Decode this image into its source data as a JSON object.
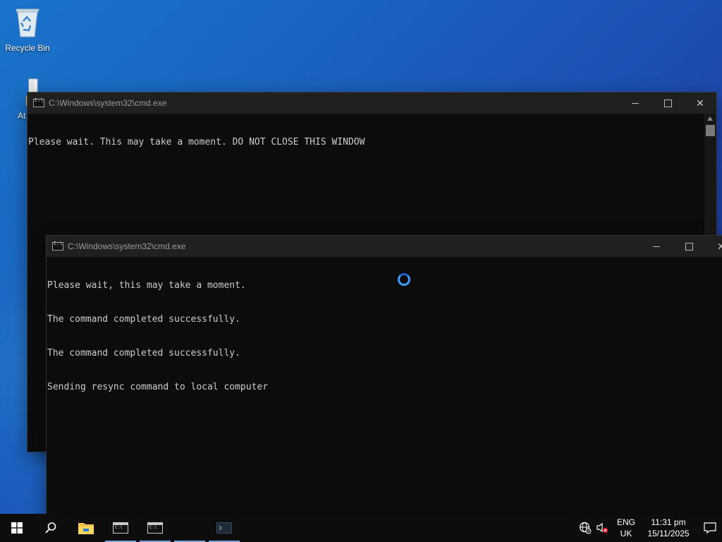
{
  "desktop": {
    "icons": [
      {
        "label": "Recycle Bin",
        "icon": "recycle-bin-icon"
      },
      {
        "label": "At",
        "icon": "folder-icon"
      }
    ]
  },
  "windows": [
    {
      "title": "C:\\Windows\\system32\\cmd.exe",
      "lines": [
        "Please wait. This may take a moment. DO NOT CLOSE THIS WINDOW"
      ]
    },
    {
      "title": "C:\\Windows\\system32\\cmd.exe",
      "lines": [
        "Please wait, this may take a moment.",
        "The command completed successfully.",
        "The command completed successfully.",
        "Sending resync command to local computer"
      ]
    }
  ],
  "taskbar": {
    "items": [
      {
        "icon": "windows-start-icon"
      },
      {
        "icon": "search-icon"
      },
      {
        "icon": "file-explorer-icon"
      },
      {
        "icon": "cmd-icon"
      },
      {
        "icon": "cmd-icon"
      },
      {
        "icon": "terminal-icon"
      }
    ],
    "tray": {
      "network_icon": "globe-network-icon",
      "volume_icon": "volume-muted-icon",
      "language": "ENG",
      "region": "UK",
      "time": "11:31 pm",
      "date": "15/11/2025",
      "notification_icon": "notification-icon"
    }
  },
  "colors": {
    "console_bg": "#0c0c0c",
    "console_text": "#cccccc",
    "titlebar": "#202020",
    "taskbar": "#0d0d0d",
    "spinner": "#3aa0ff"
  }
}
